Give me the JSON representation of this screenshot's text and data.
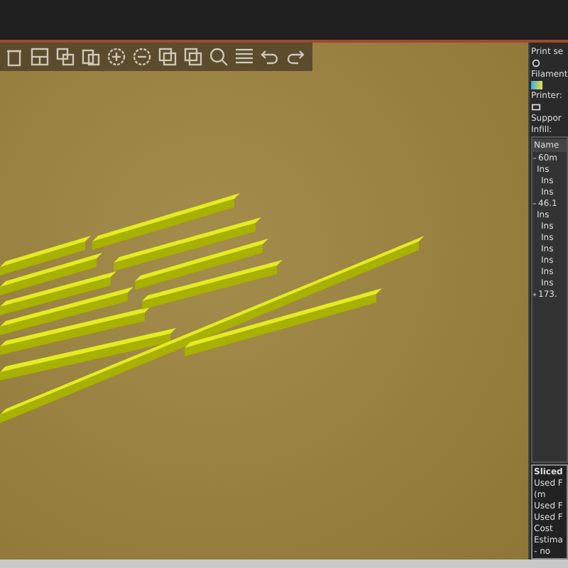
{
  "panel": {
    "print_settings_label": "Print se",
    "filament_label": "Filament",
    "printer_label": "Printer:",
    "support_label": "Suppor",
    "infill_label": "Infill:",
    "name_header": "Name",
    "objects": [
      {
        "name": "60m",
        "expanded": true,
        "children": [
          "Ins",
          "Ins",
          "Ins"
        ]
      },
      {
        "name": "46.1",
        "expanded": true,
        "children": [
          "Ins",
          "Ins",
          "Ins",
          "Ins",
          "Ins",
          "Ins",
          "Ins"
        ]
      },
      {
        "name": "173.",
        "expanded": false
      }
    ],
    "sliced_title": "Sliced",
    "sliced_rows": [
      "Used F",
      "(m",
      "Used F",
      "Used F",
      "Cost",
      "Estima",
      "- no"
    ]
  }
}
